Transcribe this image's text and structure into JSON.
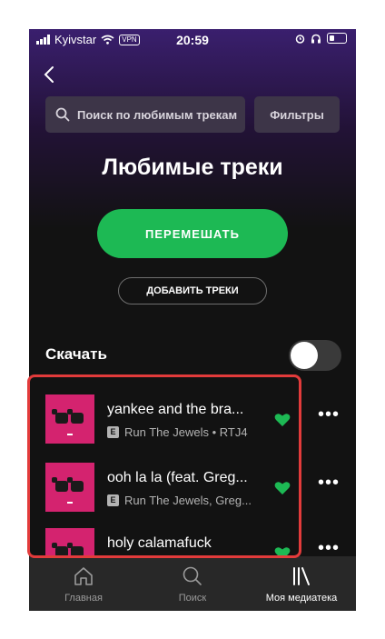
{
  "status_bar": {
    "carrier": "Kyivstar",
    "vpn": "VPN",
    "time": "20:59"
  },
  "search": {
    "placeholder": "Поиск по любимым трекам"
  },
  "filters_label": "Фильтры",
  "page_title": "Любимые треки",
  "shuffle_label": "ПЕРЕМЕШАТЬ",
  "add_tracks_label": "ДОБАВИТЬ ТРЕКИ",
  "download": {
    "label": "Скачать",
    "enabled": false
  },
  "tracks": [
    {
      "title": "yankee and the bra...",
      "badge": "E",
      "subtitle": "Run The Jewels • RTJ4",
      "liked": true
    },
    {
      "title": "ooh la la (feat. Greg...",
      "badge": "E",
      "subtitle": "Run The Jewels, Greg...",
      "liked": true
    },
    {
      "title": "holy calamafuck",
      "badge": "",
      "subtitle": "",
      "liked": true
    }
  ],
  "more_glyph": "•••",
  "tab_bar": [
    {
      "label": "Главная",
      "icon": "home-icon",
      "active": false
    },
    {
      "label": "Поиск",
      "icon": "search-icon",
      "active": false
    },
    {
      "label": "Моя медиатека",
      "icon": "library-icon",
      "active": true
    }
  ],
  "colors": {
    "accent": "#1db954",
    "highlight": "#e23b3b",
    "background": "#121212",
    "cover": "#d4236f"
  }
}
